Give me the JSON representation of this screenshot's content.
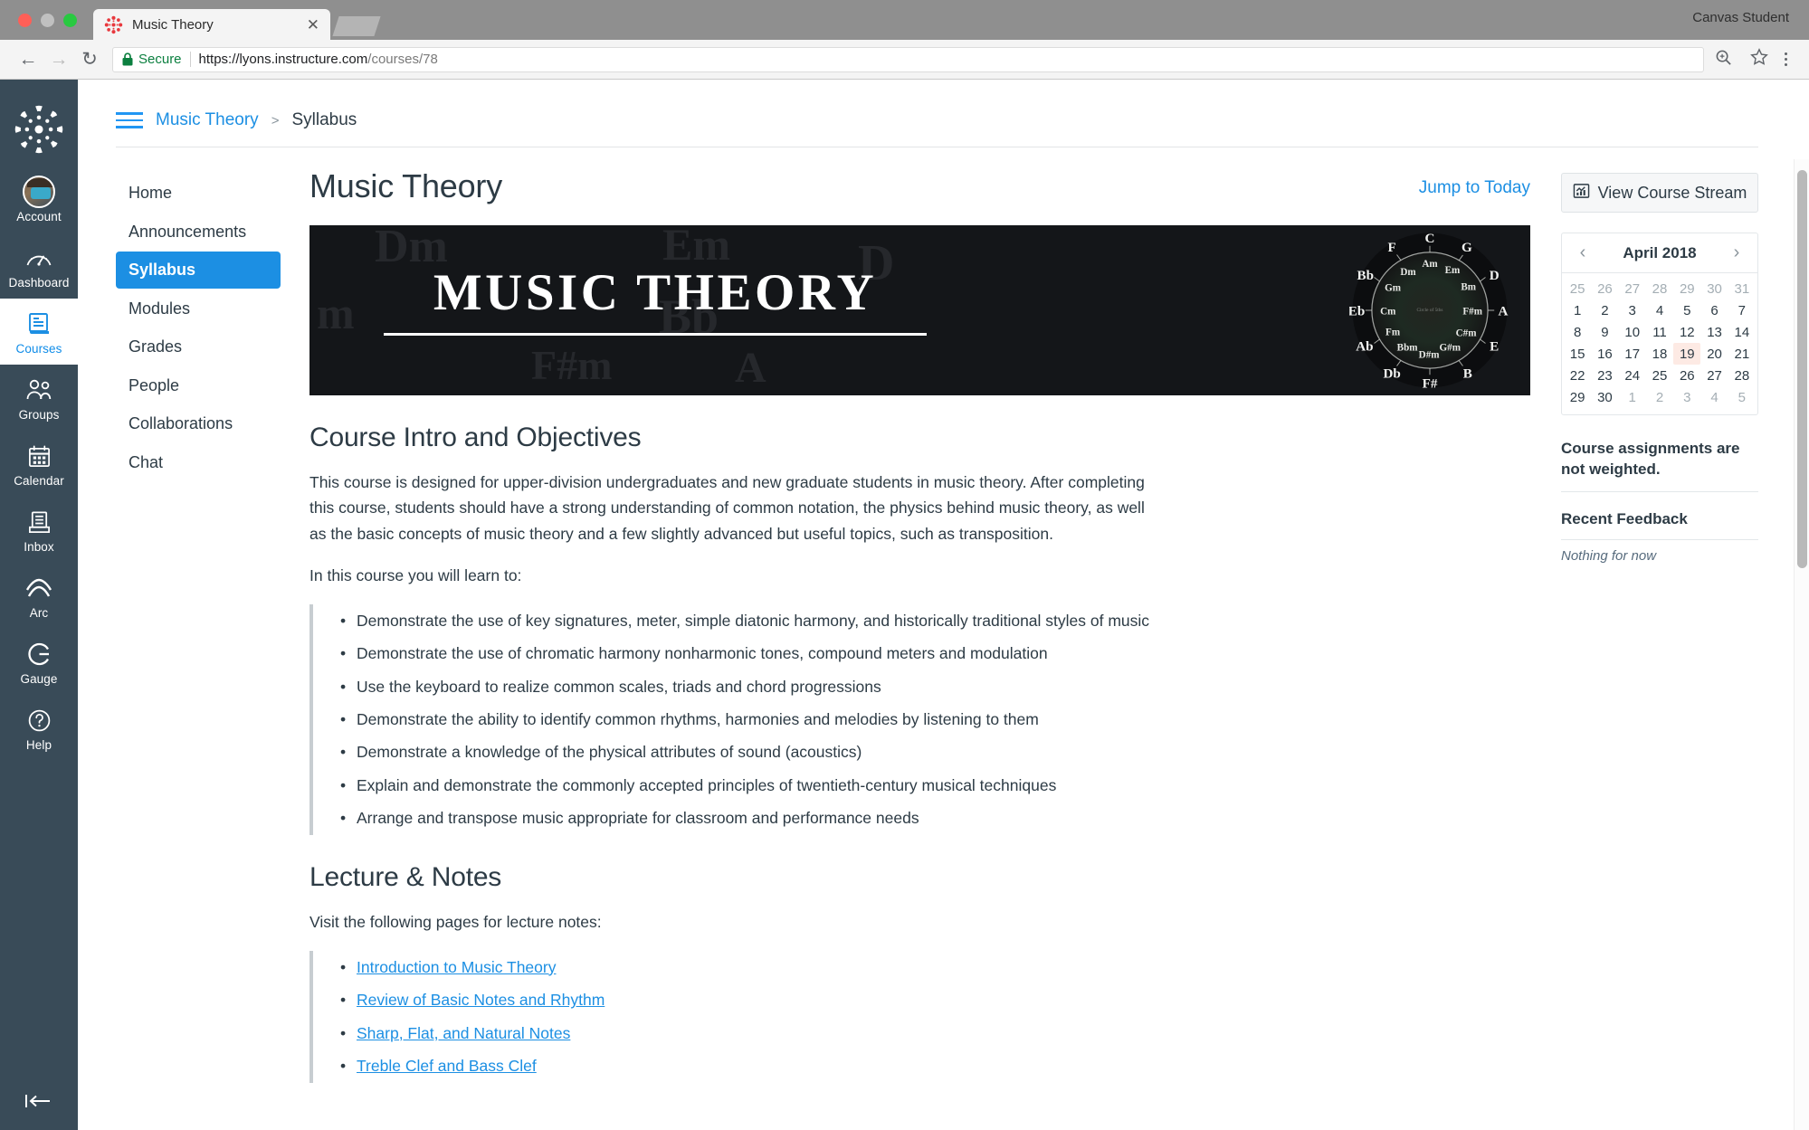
{
  "browser": {
    "tab": {
      "title": "Music Theory",
      "favicon_icon": "canvas-logo-icon",
      "close_icon": "close-icon"
    },
    "new_tab_icon": "new-tab-icon",
    "window_label": "Canvas Student",
    "back_icon": "arrow-left-icon",
    "forward_icon": "arrow-right-icon",
    "reload_icon": "reload-icon",
    "lock_icon": "lock-icon",
    "secure_label": "Secure",
    "url_domain": "https://lyons.instructure.com",
    "url_path": "/courses/78",
    "zoom_icon": "zoom-search-icon",
    "bookmark_icon": "star-icon",
    "menu_icon": "kebab-menu-icon"
  },
  "globalnav": {
    "logo_icon": "canvas-logo-icon",
    "collapse_icon": "collapse-arrow-icon",
    "items": [
      {
        "label": "Account",
        "icon": "avatar-icon",
        "active": false
      },
      {
        "label": "Dashboard",
        "icon": "dashboard-gauge-icon",
        "active": false
      },
      {
        "label": "Courses",
        "icon": "courses-book-icon",
        "active": true
      },
      {
        "label": "Groups",
        "icon": "groups-people-icon",
        "active": false
      },
      {
        "label": "Calendar",
        "icon": "calendar-icon",
        "active": false
      },
      {
        "label": "Inbox",
        "icon": "inbox-tray-icon",
        "active": false
      },
      {
        "label": "Arc",
        "icon": "arc-icon",
        "active": false
      },
      {
        "label": "Gauge",
        "icon": "gauge-g-icon",
        "active": false
      },
      {
        "label": "Help",
        "icon": "help-question-icon",
        "active": false
      }
    ]
  },
  "breadcrumb": {
    "menu_icon": "hamburger-menu-icon",
    "course": "Music Theory",
    "separator": ">",
    "current": "Syllabus"
  },
  "coursenav": {
    "items": [
      {
        "label": "Home",
        "active": false
      },
      {
        "label": "Announcements",
        "active": false
      },
      {
        "label": "Syllabus",
        "active": true
      },
      {
        "label": "Modules",
        "active": false
      },
      {
        "label": "Grades",
        "active": false
      },
      {
        "label": "People",
        "active": false
      },
      {
        "label": "Collaborations",
        "active": false
      },
      {
        "label": "Chat",
        "active": false
      }
    ]
  },
  "main": {
    "title": "Music Theory",
    "jump_to_today": "Jump to Today",
    "banner": {
      "title": "MUSIC THEORY",
      "ghost_labels": [
        "Dm",
        "Em",
        "D",
        "m",
        "Bb",
        "A",
        "F#m"
      ],
      "circle_of_fifths": {
        "center_label": "Circle of 5ths",
        "major": [
          "C",
          "G",
          "D",
          "A",
          "E",
          "B",
          "F#",
          "Db",
          "Ab",
          "Eb",
          "Bb",
          "F"
        ],
        "minor": [
          "Am",
          "Em",
          "Bm",
          "F#m",
          "C#m",
          "G#m",
          "D#m",
          "Bbm",
          "Fm",
          "Cm",
          "Gm",
          "Dm"
        ]
      }
    },
    "intro": {
      "heading": "Course Intro and Objectives",
      "paragraph": "This course is designed for upper-division undergraduates and new graduate students in music theory. After completing this course, students should have a strong understanding of common notation, the physics behind music theory, as well as the basic concepts of music theory and a few slightly advanced but useful topics, such as transposition.",
      "lead_in": "In this course you will learn to:",
      "objectives": [
        "Demonstrate the use of key signatures, meter, simple diatonic harmony, and historically traditional styles of music",
        "Demonstrate the use of chromatic harmony nonharmonic tones, compound meters and modulation",
        "Use the keyboard to realize common scales, triads and chord progressions",
        "Demonstrate the ability to identify common rhythms, harmonies and melodies by listening to them",
        "Demonstrate a knowledge of the physical attributes of sound (acoustics)",
        "Explain and demonstrate the commonly accepted principles of twentieth-century musical techniques",
        "Arrange and transpose music appropriate for classroom and performance needs"
      ]
    },
    "lecture": {
      "heading": "Lecture & Notes",
      "lead_in": "Visit the following pages for lecture notes:",
      "links": [
        "Introduction to Music Theory",
        "Review of Basic Notes and Rhythm",
        "Sharp, Flat, and Natural Notes",
        "Treble Clef and Bass Clef"
      ]
    }
  },
  "rightbar": {
    "stream_button": {
      "label": "View Course Stream",
      "icon": "course-stream-chart-icon"
    },
    "calendar": {
      "prev_icon": "chevron-left-icon",
      "next_icon": "chevron-right-icon",
      "month_label": "April 2018",
      "today": 19,
      "weeks": [
        [
          {
            "d": 25,
            "o": true
          },
          {
            "d": 26,
            "o": true
          },
          {
            "d": 27,
            "o": true
          },
          {
            "d": 28,
            "o": true
          },
          {
            "d": 29,
            "o": true
          },
          {
            "d": 30,
            "o": true
          },
          {
            "d": 31,
            "o": true
          }
        ],
        [
          {
            "d": 1
          },
          {
            "d": 2
          },
          {
            "d": 3
          },
          {
            "d": 4
          },
          {
            "d": 5
          },
          {
            "d": 6
          },
          {
            "d": 7
          }
        ],
        [
          {
            "d": 8
          },
          {
            "d": 9
          },
          {
            "d": 10
          },
          {
            "d": 11
          },
          {
            "d": 12
          },
          {
            "d": 13
          },
          {
            "d": 14
          }
        ],
        [
          {
            "d": 15
          },
          {
            "d": 16
          },
          {
            "d": 17
          },
          {
            "d": 18
          },
          {
            "d": 19,
            "t": true
          },
          {
            "d": 20
          },
          {
            "d": 21
          }
        ],
        [
          {
            "d": 22
          },
          {
            "d": 23
          },
          {
            "d": 24
          },
          {
            "d": 25
          },
          {
            "d": 26
          },
          {
            "d": 27
          },
          {
            "d": 28
          }
        ],
        [
          {
            "d": 29
          },
          {
            "d": 30
          },
          {
            "d": 1,
            "o": true
          },
          {
            "d": 2,
            "o": true
          },
          {
            "d": 3,
            "o": true
          },
          {
            "d": 4,
            "o": true
          },
          {
            "d": 5,
            "o": true
          }
        ]
      ]
    },
    "weight_note": "Course assignments are not weighted.",
    "recent_feedback_heading": "Recent Feedback",
    "recent_feedback_empty": "Nothing for now"
  },
  "colors": {
    "brand": "#1c8fe3",
    "nav_bg": "#394b58",
    "text": "#2d3b45",
    "today_highlight": "#fdeae4",
    "secure_green": "#0b7f3f"
  }
}
